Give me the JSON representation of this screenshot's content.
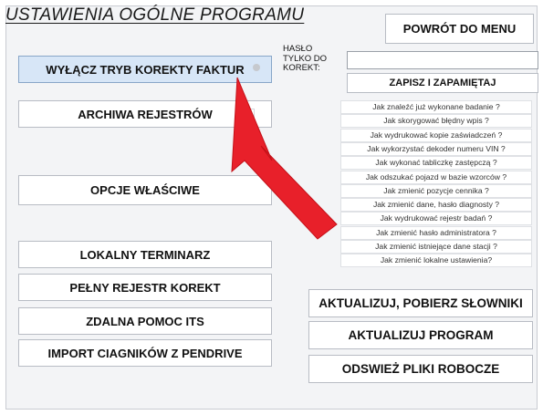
{
  "title": "USTAWIENIA OGÓLNE  PROGRAMU",
  "back_button": "POWRÓT DO MENU",
  "left_buttons": {
    "correction_mode": "WYŁĄCZ TRYB KOREKTY FAKTUR",
    "registry_archives": "ARCHIWA REJESTRÓW",
    "own_options": "OPCJE WŁAŚCIWE",
    "local_scheduler": "LOKALNY  TERMINARZ",
    "full_correction_registry": "PEŁNY REJESTR KOREKT",
    "remote_help": "ZDALNA  POMOC  ITS",
    "import_tractors": "IMPORT CIAGNIKÓW Z PENDRIVE"
  },
  "password": {
    "label": "HASŁO TYLKO DO KOREKT:",
    "value": "",
    "save_button": "ZAPISZ I ZAPAMIĘTAJ"
  },
  "faq": [
    "Jak znaleźć już wykonane badanie ?",
    "Jak skorygować błędny wpis ?",
    "Jak wydrukować kopie zaświadczeń ?",
    "Jak wykorzystać dekoder numeru VIN ?",
    "Jak wykonać tabliczkę zastępczą ?",
    "Jak odszukać pojazd w bazie wzorców ?",
    "Jak zmienić pozycje cennika ?",
    "Jak zmienić dane, hasło diagnosty ?",
    "Jak wydrukować rejestr badań ?",
    "Jak zmienić hasło administratora ?",
    "Jak zmienić istniejące dane stacji ?",
    "Jak zmienić lokalne ustawienia?"
  ],
  "right_buttons": {
    "update_dictionaries": "AKTUALIZUJ, POBIERZ SŁOWNIKI",
    "update_program": "AKTUALIZUJ  PROGRAM",
    "refresh_files": "ODSWIEŻ  PLIKI  ROBOCZE"
  },
  "colors": {
    "active_button": "#d7e6f7",
    "arrow": "#e8202a",
    "background": "#f3f4f6"
  }
}
